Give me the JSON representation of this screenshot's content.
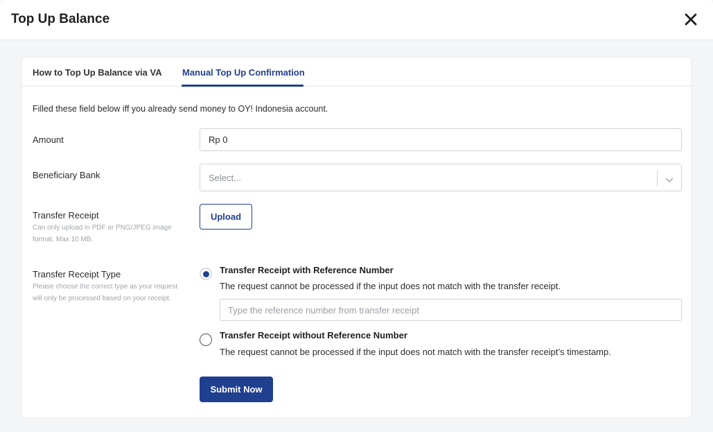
{
  "modal": {
    "title": "Top Up Balance"
  },
  "tabs": [
    {
      "label": "How to Top Up Balance via VA"
    },
    {
      "label": "Manual Top Up Confirmation"
    }
  ],
  "form": {
    "intro": "Filled these field below iff you already send money to OY! Indonesia account.",
    "amount": {
      "label": "Amount",
      "value": "Rp 0"
    },
    "bank": {
      "label": "Beneficiary Bank",
      "placeholder": "Select..."
    },
    "receipt": {
      "label": "Transfer Receipt",
      "hint": "Can only upload in PDF or PNG/JPEG image format. Max 10 MB.",
      "upload_label": "Upload"
    },
    "receipt_type": {
      "label": "Transfer Receipt Type",
      "hint": "Please choose the correct type as your request will only be processed based on your receipt.",
      "options": [
        {
          "title": "Transfer Receipt with Reference Number",
          "description": "The request cannot be processed if the input does not match with the transfer receipt.",
          "input_placeholder": "Type the reference number from transfer receipt"
        },
        {
          "title": "Transfer Receipt without Reference Number",
          "description": "The request cannot be processed if the input does not match with the transfer receipt’s timestamp."
        }
      ]
    },
    "submit_label": "Submit Now"
  }
}
